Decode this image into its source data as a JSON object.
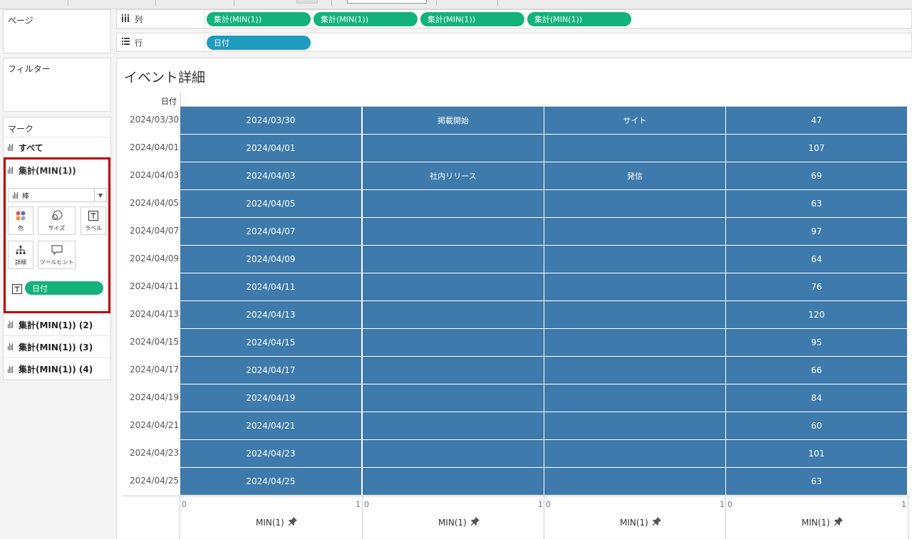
{
  "shelves": {
    "pages_title": "ページ",
    "filters_title": "フィルター",
    "columns": {
      "label": "列",
      "pills": [
        "集計(MIN(1))",
        "集計(MIN(1))",
        "集計(MIN(1))",
        "集計(MIN(1))"
      ]
    },
    "rows": {
      "label": "行",
      "pills": [
        "日付"
      ]
    }
  },
  "marks": {
    "title": "マーク",
    "all": "すべて",
    "selected": "集計(MIN(1))",
    "mark_type": "棒",
    "buttons": {
      "color": "色",
      "size": "サイズ",
      "label": "ラベル",
      "detail": "詳細",
      "tooltip": "ツールヒント"
    },
    "label_field": "日付",
    "others": [
      "集計(MIN(1)) (2)",
      "集計(MIN(1)) (3)",
      "集計(MIN(1)) (4)"
    ]
  },
  "view": {
    "title": "イベント詳細",
    "row_header": "日付",
    "rows": [
      {
        "date": "2024/03/30",
        "c1": "2024/03/30",
        "c2": "掲載開始",
        "c3": "サイト",
        "c4": "47"
      },
      {
        "date": "2024/04/01",
        "c1": "2024/04/01",
        "c2": "",
        "c3": "",
        "c4": "107"
      },
      {
        "date": "2024/04/03",
        "c1": "2024/04/03",
        "c2": "社内リリース",
        "c3": "発信",
        "c4": "69"
      },
      {
        "date": "2024/04/05",
        "c1": "2024/04/05",
        "c2": "",
        "c3": "",
        "c4": "63"
      },
      {
        "date": "2024/04/07",
        "c1": "2024/04/07",
        "c2": "",
        "c3": "",
        "c4": "97"
      },
      {
        "date": "2024/04/09",
        "c1": "2024/04/09",
        "c2": "",
        "c3": "",
        "c4": "64"
      },
      {
        "date": "2024/04/11",
        "c1": "2024/04/11",
        "c2": "",
        "c3": "",
        "c4": "76"
      },
      {
        "date": "2024/04/13",
        "c1": "2024/04/13",
        "c2": "",
        "c3": "",
        "c4": "120"
      },
      {
        "date": "2024/04/15",
        "c1": "2024/04/15",
        "c2": "",
        "c3": "",
        "c4": "95"
      },
      {
        "date": "2024/04/17",
        "c1": "2024/04/17",
        "c2": "",
        "c3": "",
        "c4": "66"
      },
      {
        "date": "2024/04/19",
        "c1": "2024/04/19",
        "c2": "",
        "c3": "",
        "c4": "84"
      },
      {
        "date": "2024/04/21",
        "c1": "2024/04/21",
        "c2": "",
        "c3": "",
        "c4": "60"
      },
      {
        "date": "2024/04/23",
        "c1": "2024/04/23",
        "c2": "",
        "c3": "",
        "c4": "101"
      },
      {
        "date": "2024/04/25",
        "c1": "2024/04/25",
        "c2": "",
        "c3": "",
        "c4": "63"
      }
    ],
    "axis": {
      "min_label": "0",
      "max_label": "1",
      "title": "MIN(1)"
    }
  },
  "colors": {
    "bar": "#3e7aab",
    "pill_green": "#13b27a",
    "pill_blue": "#1f9bbd",
    "highlight": "#c00000"
  },
  "icons": {
    "columns": "columns-icon",
    "rows": "rows-icon",
    "pin": "pin-icon"
  }
}
